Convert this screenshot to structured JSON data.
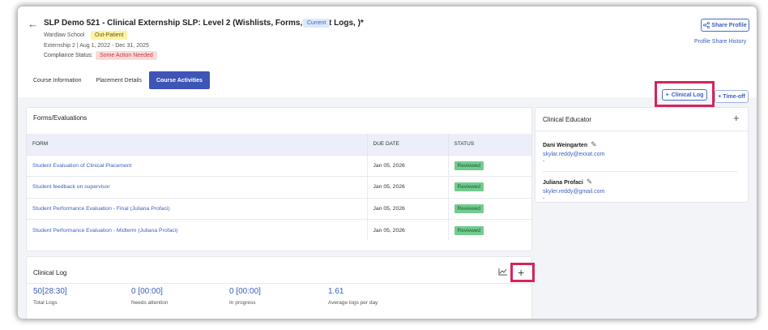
{
  "header": {
    "back_icon": "back-arrow-icon",
    "title": "SLP Demo 521 - Clinical Externship SLP: Level 2 (Wishlists, Forms, Patient Logs, )*",
    "badge_current": "Current",
    "school": "Wardlaw School",
    "badge_outpatient": "Out-Patient",
    "externship": "Externship 2  |  Aug 1, 2022 - Dec 31, 2025",
    "compliance_label": "Compliance Status:",
    "compliance_value": "Some Action Needed",
    "share_profile": "Share Profile",
    "share_history": "Profile Share History"
  },
  "tabs": [
    {
      "label": "Course Information",
      "active": false
    },
    {
      "label": "Placement Details",
      "active": false
    },
    {
      "label": "Course Activities",
      "active": true
    }
  ],
  "actions": {
    "clinical_log": "Clinical Log",
    "time_off": "Time-off"
  },
  "forms": {
    "title": "Forms/Evaluations",
    "columns": [
      "FORM",
      "DUE DATE",
      "STATUS"
    ],
    "rows": [
      {
        "form": "Student Evaluation of Clinical Placement",
        "due": "Jan 05, 2026",
        "status": "Reviewed"
      },
      {
        "form": "Student feedback on supervisor",
        "due": "Jan 05, 2026",
        "status": "Reviewed"
      },
      {
        "form": "Student Performance Evaluation - Final (Juliana Profaci)",
        "due": "Jan 05, 2026",
        "status": "Reviewed"
      },
      {
        "form": "Student Performance Evaluation - Midterm (Juliana Profaci)",
        "due": "Jan 05, 2026",
        "status": "Reviewed"
      }
    ]
  },
  "clinical_log": {
    "title": "Clinical Log",
    "stats": [
      {
        "value": "50[28:30]",
        "label": "Total Logs"
      },
      {
        "value": "0 [00:00]",
        "label": "Needs attention"
      },
      {
        "value": "0 [00:00]",
        "label": "In progress"
      },
      {
        "value": "1.61",
        "label": "Average logs per day"
      }
    ]
  },
  "educator": {
    "title": "Clinical Educator",
    "people": [
      {
        "name": "Dani Weingarten",
        "email": "skylar.reddy@exxat.com",
        "extra": "-"
      },
      {
        "name": "Juliana Profaci",
        "email": "skyler.reddy@gmail.com",
        "extra": "-"
      }
    ]
  },
  "colors": {
    "primary": "#3d55b7",
    "link": "#3b5fc0",
    "highlight": "#d6245b",
    "reviewed": "#72cc8f"
  }
}
